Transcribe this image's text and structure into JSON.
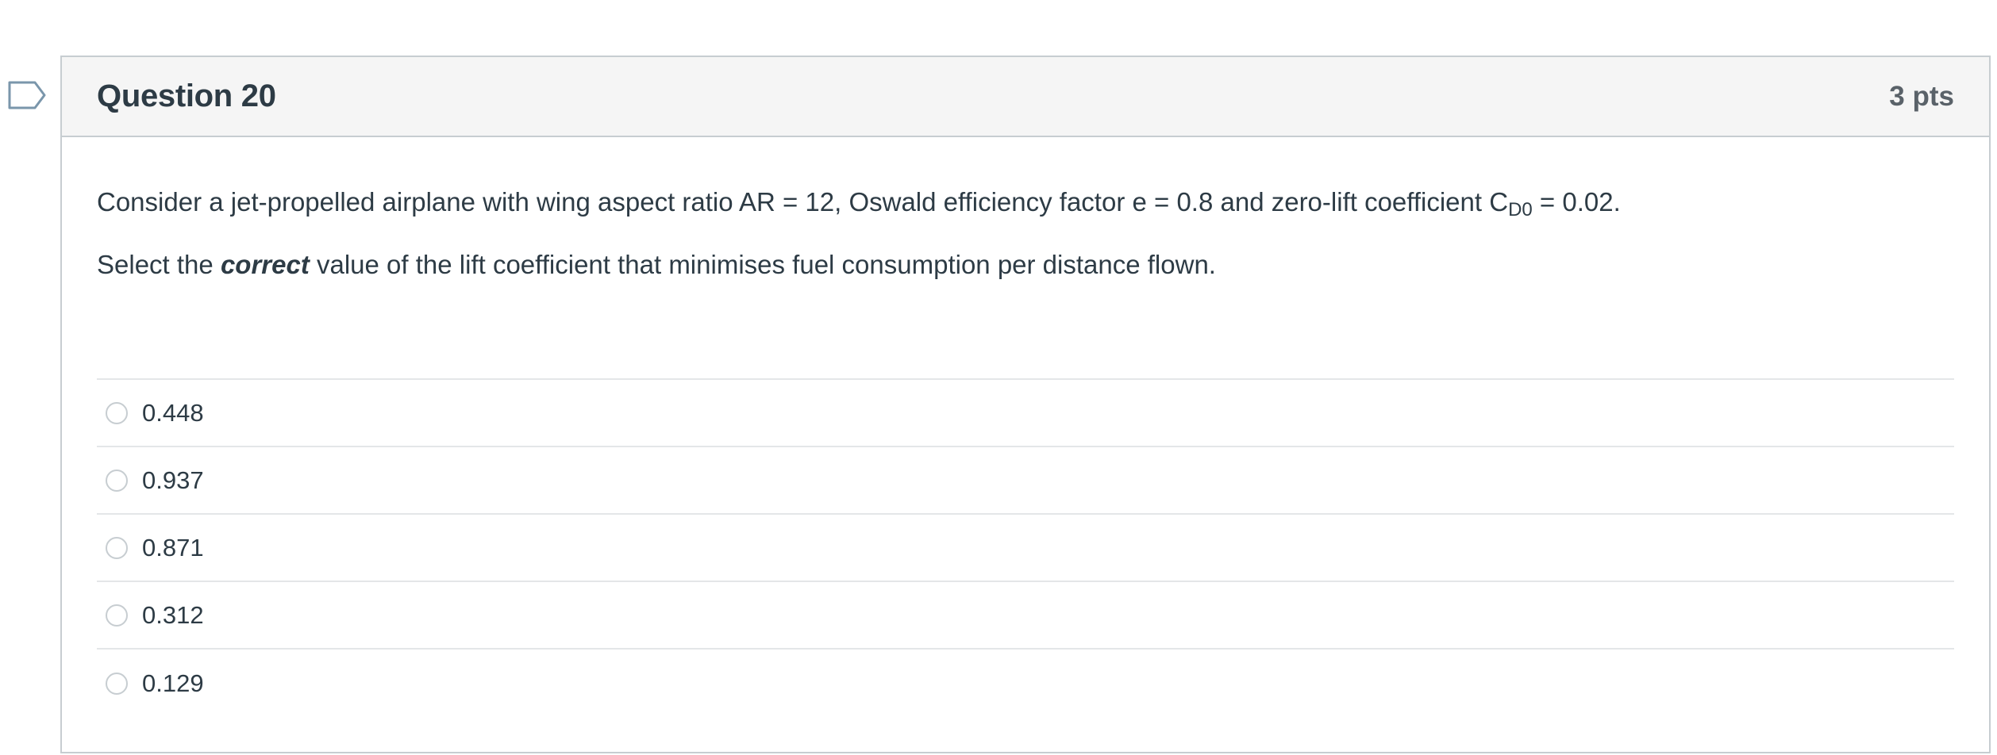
{
  "question": {
    "title": "Question 20",
    "points": "3 pts",
    "text_before_sub": "Consider a jet-propelled airplane with wing aspect ratio AR = 12, Oswald efficiency factor e = 0.8 and zero-lift coefficient C",
    "text_sub": "D0",
    "text_after_sub": " = 0.02.",
    "prompt_before": "Select the ",
    "prompt_emphasis": "correct",
    "prompt_after": " value of the lift coefficient that minimises fuel consumption per distance flown."
  },
  "answers": [
    {
      "label": "0.448"
    },
    {
      "label": "0.937"
    },
    {
      "label": "0.871"
    },
    {
      "label": "0.312"
    },
    {
      "label": "0.129"
    }
  ],
  "colors": {
    "flag_stroke": "#7a96ab",
    "border": "#c7cdd1",
    "header_bg": "#f5f5f5",
    "text": "#2d3b45"
  },
  "icons": {
    "flag": "bookmark-flag-icon",
    "radio": "radio-button-unselected"
  }
}
